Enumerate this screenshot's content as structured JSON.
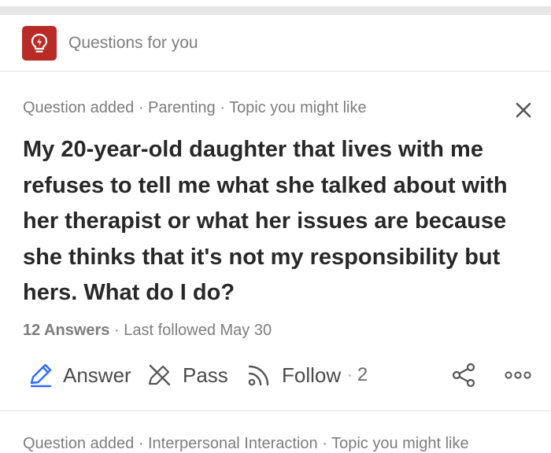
{
  "section": {
    "title": "Questions for you",
    "icon": "lightbulb-icon",
    "brand_color": "#b92b27"
  },
  "card": {
    "meta": {
      "type": "Question added",
      "sep1": " · ",
      "topic": "Parenting",
      "sep2": " · ",
      "reason": "Topic you might like"
    },
    "question": "My 20-year-old daughter that lives with me refuses to tell me what she talked about with her therapist or what her issues are because she thinks that it's not my responsibility but hers. What do I do?",
    "stats": {
      "answers": "12 Answers",
      "sep": " · ",
      "followed": "Last followed May 30"
    },
    "actions": {
      "answer": "Answer",
      "pass": "Pass",
      "follow": "Follow",
      "follow_sep": "·",
      "follow_count": "2"
    },
    "accent_color": "#2e69ff"
  },
  "next_card_peek": "Question added · Interpersonal Interaction · Topic you might like"
}
